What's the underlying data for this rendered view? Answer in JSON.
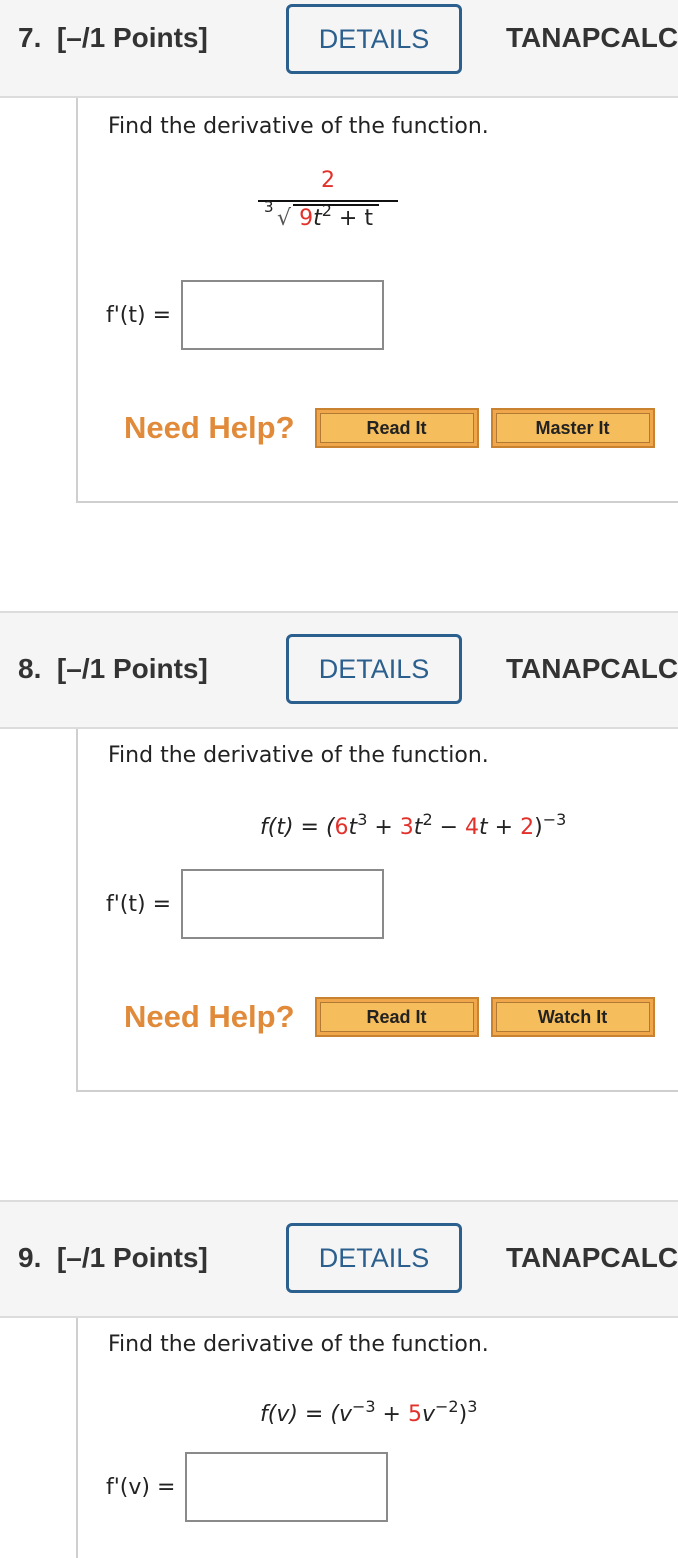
{
  "questions": [
    {
      "number": "7.",
      "points": "[–/1 Points]",
      "details_label": "DETAILS",
      "course_code": "TANAPCALC",
      "prompt": "Find the derivative of the function.",
      "function": {
        "numerator": "2",
        "root_index": "3",
        "radicand_coef": "9",
        "radicand_var": "t",
        "radicand_exp": "2",
        "radicand_rest": "+ t"
      },
      "answer_label": "f'(t) =",
      "answer_value": "",
      "help_label": "Need Help?",
      "help_buttons": [
        "Read It",
        "Master It"
      ]
    },
    {
      "number": "8.",
      "points": "[–/1 Points]",
      "details_label": "DETAILS",
      "course_code": "TANAPCALC",
      "prompt": "Find the derivative of the function.",
      "function": {
        "lhs": "f(t) = (",
        "c1": "6",
        "v1": "t",
        "e1": "3",
        "op1": " + ",
        "c2": "3",
        "v2": "t",
        "e2": "2",
        "op2": " − ",
        "c3": "4",
        "v3": "t",
        "op3": " + ",
        "c4": "2",
        "close": ")",
        "outer_exp": "−3"
      },
      "answer_label": "f'(t) =",
      "answer_value": "",
      "help_label": "Need Help?",
      "help_buttons": [
        "Read It",
        "Watch It"
      ]
    },
    {
      "number": "9.",
      "points": "[–/1 Points]",
      "details_label": "DETAILS",
      "course_code": "TANAPCALC",
      "prompt": "Find the derivative of the function.",
      "function": {
        "lhs": "f(v) = (",
        "v1": "v",
        "e1": "−3",
        "op1": " + ",
        "c2": "5",
        "v2": "v",
        "e2": "−2",
        "close": ")",
        "outer_exp": "3"
      },
      "answer_label": "f'(v) =",
      "answer_value": ""
    }
  ]
}
